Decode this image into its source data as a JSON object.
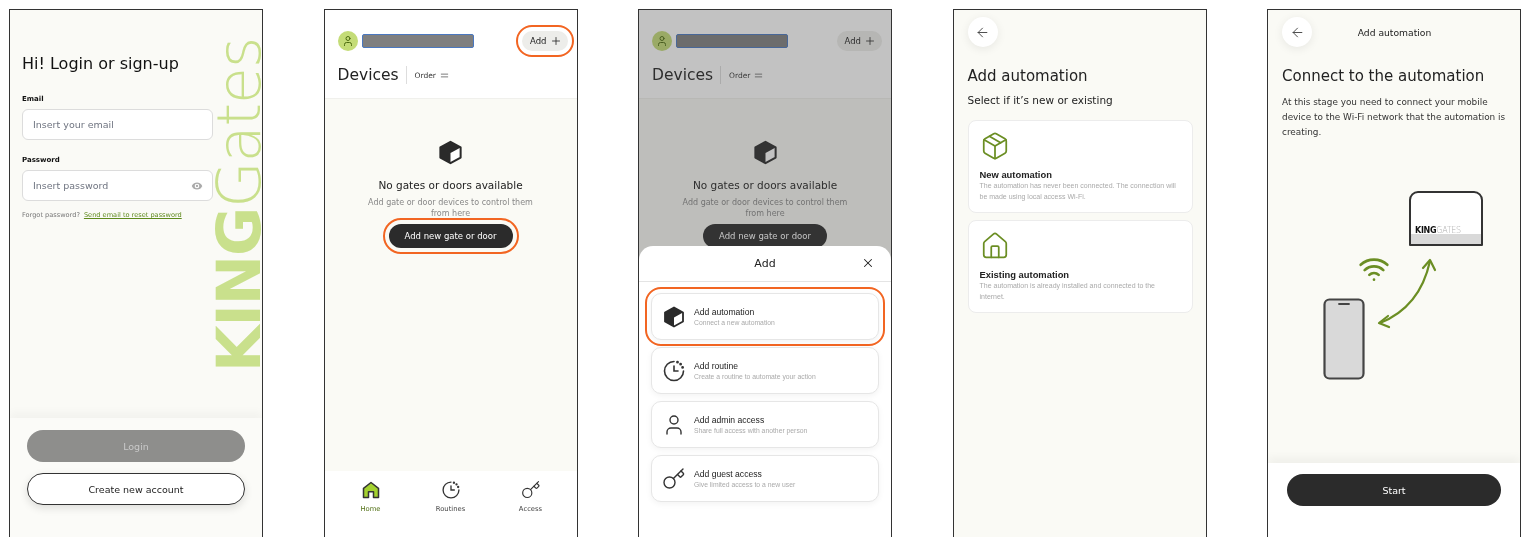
{
  "screens": [
    {
      "kind": "login",
      "watermark": "**KING**Gates",
      "title": "Hi! Login or sign-up",
      "fields": [
        {
          "kind": "text",
          "label": "Email",
          "placeholder": "Insert your email"
        },
        {
          "kind": "password",
          "label": "Password",
          "placeholder": "Insert password"
        }
      ],
      "forgot": {
        "text": "Forgot password?",
        "link": "Send email to reset password"
      },
      "buttons": [
        {
          "kind": "primary",
          "label": "Login",
          "disabled": true
        },
        {
          "kind": "outline",
          "label": "Create new account",
          "disabled": false
        }
      ]
    },
    {
      "kind": "devices",
      "dimmed": false,
      "add_button": {
        "label": "Add",
        "highlighted": true
      },
      "title": "Devices",
      "order": "Order",
      "empty": {
        "title": "No gates or doors available",
        "text": "Add gate or door devices to control them from here",
        "button": {
          "label": "Add new gate or door",
          "highlighted": true
        }
      },
      "nav": [
        {
          "kind": "home",
          "label": "Home",
          "selected": true
        },
        {
          "kind": "clock",
          "label": "Routines",
          "selected": false
        },
        {
          "kind": "key",
          "label": "Access",
          "selected": false
        }
      ]
    },
    {
      "kind": "devices",
      "dimmed": true,
      "add_button": {
        "label": "Add",
        "highlighted": false
      },
      "title": "Devices",
      "order": "Order",
      "empty": {
        "title": "No gates or doors available",
        "text": "Add gate or door devices to control them from here",
        "button": {
          "label": "Add new gate or door",
          "highlighted": false
        }
      },
      "sheet": {
        "title": "Add",
        "items": [
          {
            "kind": "cube",
            "title": "Add automation",
            "subtitle": "Connect a new automation",
            "highlighted": true
          },
          {
            "kind": "clock",
            "title": "Add routine",
            "subtitle": "Create a routine to automate your action",
            "highlighted": false
          },
          {
            "kind": "user",
            "title": "Add admin access",
            "subtitle": "Share full access with another person",
            "highlighted": false
          },
          {
            "kind": "key",
            "title": "Add guest access",
            "subtitle": "Give limited access to a new user",
            "highlighted": false
          }
        ]
      }
    },
    {
      "kind": "choose",
      "title": "Add automation",
      "subtitle": "Select if it’s new or existing",
      "options": [
        {
          "kind": "package",
          "title": "New automation",
          "text": "The automation has never been connected. The connection will be made using local access Wi-Fi."
        },
        {
          "kind": "house",
          "title": "Existing automation",
          "text": "The automation is already installed and connected to the internet."
        }
      ]
    },
    {
      "kind": "connect",
      "header_title": "Add automation",
      "title": "Connect to the automation",
      "text": "At this stage you need to connect your mobile device to the Wi-Fi network that the automation is creating.",
      "device_label": "**KING**GATES",
      "button": "Start"
    }
  ]
}
